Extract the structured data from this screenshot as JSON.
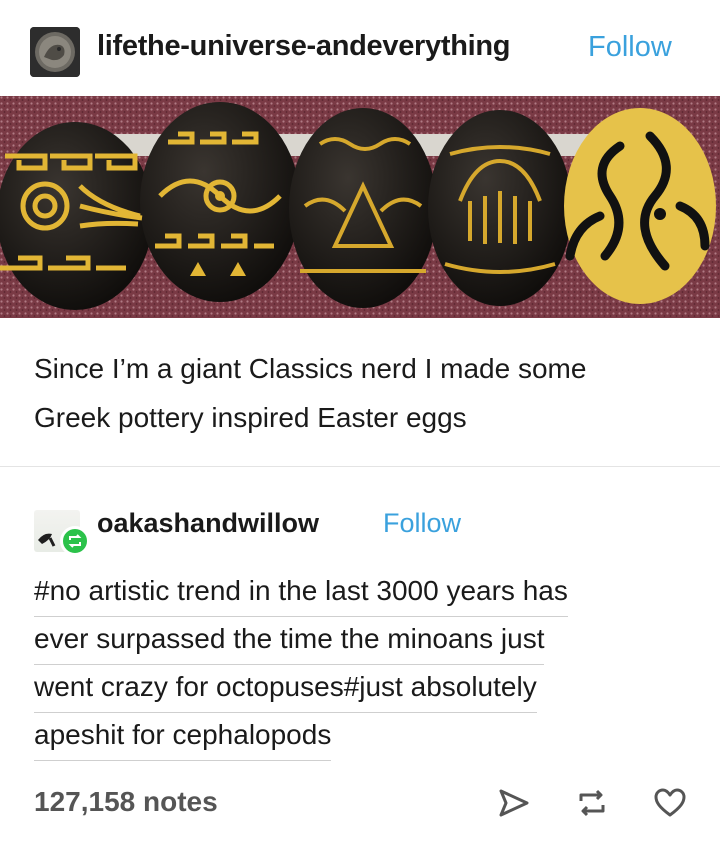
{
  "post": {
    "author": "lifethe-universe-andeverything",
    "follow_label": "Follow",
    "caption_lines": [
      "Since I’m a giant Classics nerd I made some",
      "Greek pottery inspired Easter eggs"
    ]
  },
  "reblog": {
    "author": "oakashandwillow",
    "follow_label": "Follow",
    "tag_lines": [
      "#no artistic trend in the last 3000 years has",
      "ever surpassed the time the minoans just",
      "went crazy for octopuses#just absolutely",
      "apeshit for cephalopods"
    ]
  },
  "footer": {
    "notes": "127,158 notes",
    "icons": [
      "share-icon",
      "reblog-icon",
      "heart-icon"
    ]
  },
  "colors": {
    "accent": "#3aa1dd",
    "reblog_green": "#2bc24a",
    "egg_black": "#141210",
    "egg_gold": "#e2b635",
    "carpet": "#7a3a45"
  }
}
